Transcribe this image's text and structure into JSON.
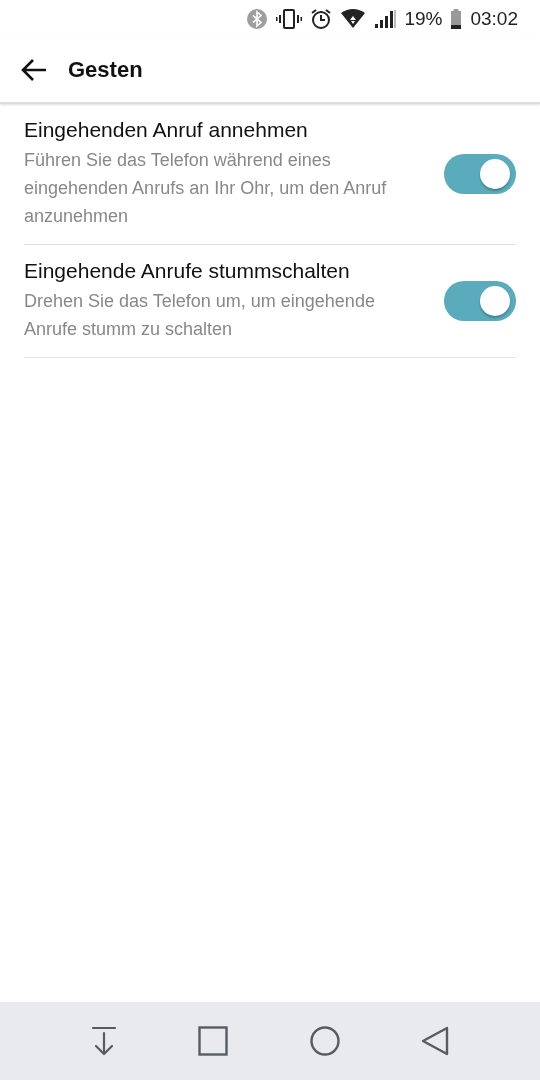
{
  "status_bar": {
    "battery": "19%",
    "time": "03:02"
  },
  "header": {
    "title": "Gesten"
  },
  "settings": [
    {
      "title": "Eingehenden Anruf annehmen",
      "description": "Führen Sie das Telefon während eines eingehenden Anrufs an Ihr Ohr, um den Anruf anzunehmen",
      "on": true
    },
    {
      "title": "Eingehende Anrufe stummschalten",
      "description": "Drehen Sie das Telefon um, um eingehende Anrufe stumm zu schalten",
      "on": true
    }
  ]
}
